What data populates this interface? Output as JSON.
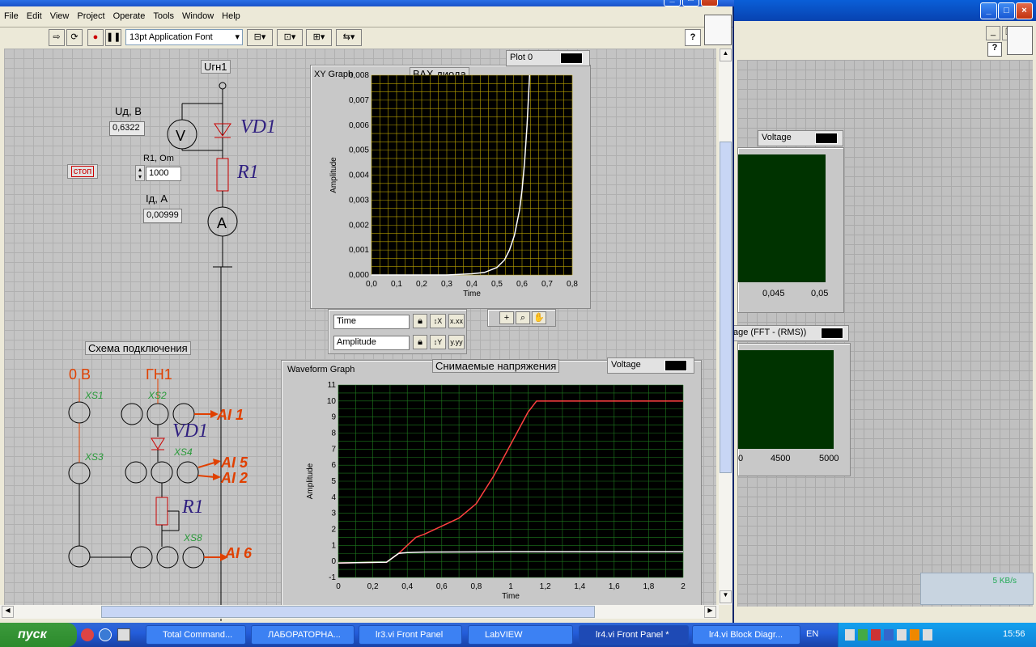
{
  "window": {
    "title": "lr4.vi Front Panel"
  },
  "menu": [
    "File",
    "Edit",
    "View",
    "Project",
    "Operate",
    "Tools",
    "Window",
    "Help"
  ],
  "toolbar": {
    "font": "13pt Application Font",
    "help": "?"
  },
  "circuit": {
    "source_label": "Uгн1",
    "voltage_label": "Uд, В",
    "voltage_value": "0,6322",
    "r_label": "R1, Om",
    "r_value": "1000",
    "current_label": "Iд, А",
    "current_value": "0,00999",
    "stop_button": "стоп",
    "vd1": "VD1",
    "r1": "R1",
    "v_meter": "V",
    "a_meter": "A"
  },
  "schema": {
    "title": "Схема подключения",
    "zero": "0 В",
    "gn1": "ГН1",
    "xs1": "XS1",
    "xs2": "XS2",
    "xs3": "XS3",
    "xs4": "XS4",
    "xs8": "XS8",
    "vd1": "VD1",
    "r1": "R1",
    "ai1": "AI 1",
    "ai5": "AI 5",
    "ai2": "AI 2",
    "ai6": "AI 6"
  },
  "xy_graph": {
    "caption": "XY Graph",
    "title": "ВАХ диода",
    "plot_legend": "Plot 0",
    "x_name": "Time",
    "y_name": "Amplitude",
    "x_ticks": [
      "0,0",
      "0,1",
      "0,2",
      "0,3",
      "0,4",
      "0,5",
      "0,6",
      "0,7",
      "0,8"
    ],
    "y_ticks": [
      "0,008",
      "0,007",
      "0,006",
      "0,005",
      "0,004",
      "0,003",
      "0,002",
      "0,001",
      "0,000"
    ]
  },
  "waveform": {
    "caption": "Waveform Graph",
    "title": "Снимаемые напряжения",
    "plot_legend": "Voltage",
    "x_name": "Time",
    "y_name": "Amplitude",
    "x_ticks": [
      "0",
      "0,2",
      "0,4",
      "0,6",
      "0,8",
      "1",
      "1,2",
      "1,4",
      "1,6",
      "1,8",
      "2"
    ],
    "y_ticks": [
      "11",
      "10",
      "9",
      "8",
      "7",
      "6",
      "5",
      "4",
      "3",
      "2",
      "1",
      "0",
      "-1"
    ]
  },
  "bg_window": {
    "legend1": "Voltage",
    "ticks1": [
      "0,045",
      "0,05"
    ],
    "legend2": "age (FFT - (RMS))",
    "ticks2": [
      "0",
      "4500",
      "5000"
    ],
    "speed": "5 KB/s"
  },
  "taskbar": {
    "start": "пуск",
    "tasks": [
      "Total Command...",
      "ЛАБОРАТОРНА...",
      "lr3.vi Front Panel",
      "LabVIEW",
      "lr4.vi Front Panel *",
      "lr4.vi Block Diagr..."
    ],
    "lang": "EN",
    "clock": "15:56"
  },
  "chart_data": [
    {
      "type": "line",
      "title": "ВАХ диода",
      "xlabel": "Time",
      "ylabel": "Amplitude",
      "xlim": [
        0,
        0.8
      ],
      "ylim": [
        0,
        0.008
      ],
      "series": [
        {
          "name": "Plot 0",
          "x": [
            0,
            0.3,
            0.4,
            0.45,
            0.5,
            0.53,
            0.55,
            0.57,
            0.59,
            0.6,
            0.61,
            0.62,
            0.63
          ],
          "y": [
            0,
            0,
            5e-05,
            0.0001,
            0.0003,
            0.0006,
            0.001,
            0.0016,
            0.0026,
            0.0034,
            0.0045,
            0.006,
            0.008
          ]
        }
      ]
    },
    {
      "type": "line",
      "title": "Снимаемые напряжения",
      "xlabel": "Time",
      "ylabel": "Amplitude",
      "xlim": [
        0,
        2
      ],
      "ylim": [
        -1,
        11
      ],
      "series": [
        {
          "name": "Voltage",
          "x": [
            0,
            0.28,
            0.35,
            0.45,
            0.5,
            0.6,
            0.7,
            0.8,
            0.9,
            1.0,
            1.1,
            1.15,
            1.2,
            1.5,
            2.0
          ],
          "y": [
            -0.1,
            -0.05,
            0.5,
            1.5,
            1.7,
            2.2,
            2.7,
            3.6,
            5.3,
            7.3,
            9.3,
            10,
            10,
            10,
            10
          ]
        },
        {
          "x": [
            0,
            0.28,
            0.35,
            0.4,
            0.5,
            1.0,
            2.0
          ],
          "y": [
            -0.1,
            -0.05,
            0.5,
            0.55,
            0.58,
            0.6,
            0.6
          ]
        }
      ]
    }
  ]
}
